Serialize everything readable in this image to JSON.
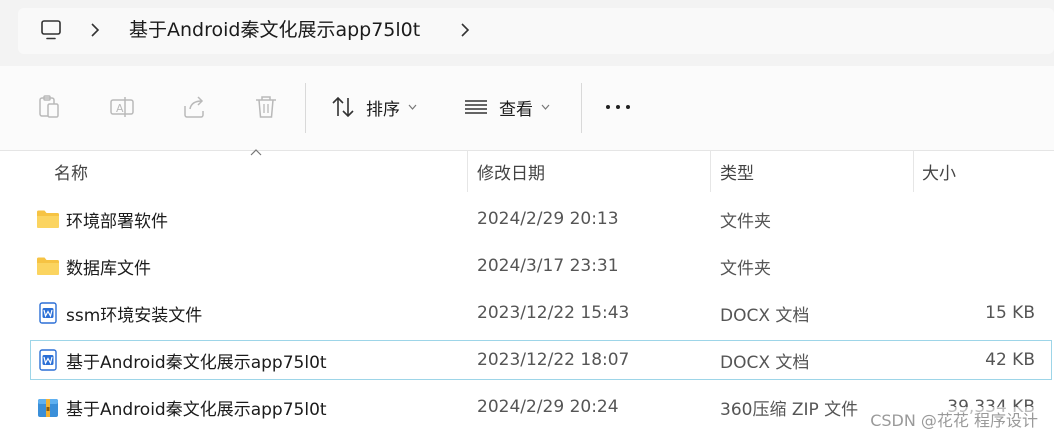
{
  "address": {
    "breadcrumb": "基于Android秦文化展示app75l0t"
  },
  "toolbar": {
    "sort_label": "排序",
    "view_label": "查看"
  },
  "columns": [
    "名称",
    "修改日期",
    "类型",
    "大小"
  ],
  "files": [
    {
      "name": "环境部署软件",
      "date": "2024/2/29 20:13",
      "type": "文件夹",
      "size": "",
      "icon": "folder-icon"
    },
    {
      "name": "数据库文件",
      "date": "2024/3/17 23:31",
      "type": "文件夹",
      "size": "",
      "icon": "folder-icon"
    },
    {
      "name": "ssm环境安装文件",
      "date": "2023/12/22 15:43",
      "type": "DOCX 文档",
      "size": "15 KB",
      "icon": "docx-icon"
    },
    {
      "name": "基于Android秦文化展示app75l0t",
      "date": "2023/12/22 18:07",
      "type": "DOCX 文档",
      "size": "42 KB",
      "icon": "docx-icon"
    },
    {
      "name": "基于Android秦文化展示app75l0t",
      "date": "2024/2/29 20:24",
      "type": "360压缩 ZIP 文件",
      "size": "39,334 KB",
      "icon": "zip-archive-icon"
    }
  ],
  "watermark": "CSDN @花花 程序设计",
  "colors": {
    "selection_border": "#9dd5e8",
    "folder": "#f6c343",
    "docx": "#2b6fd6"
  }
}
